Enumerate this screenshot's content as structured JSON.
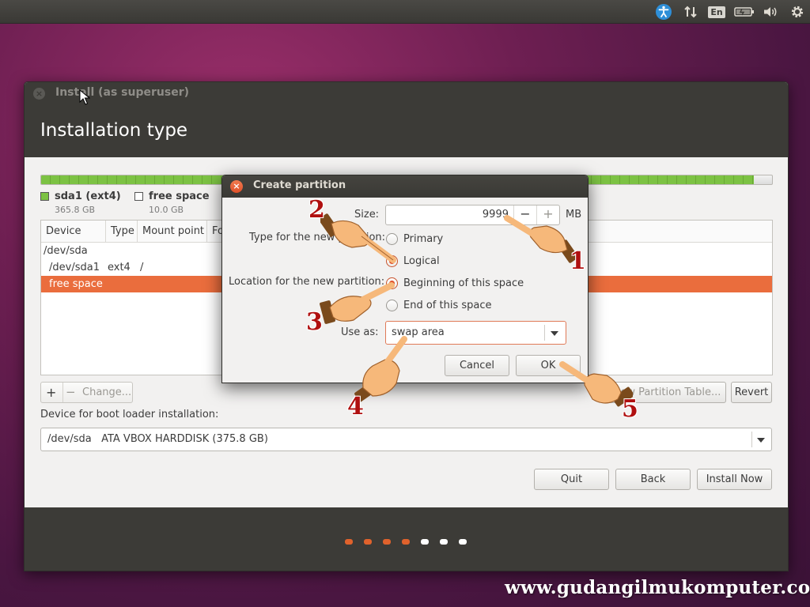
{
  "top_panel": {
    "icons": [
      "accessibility-icon",
      "network-arrows-icon",
      "keyboard-layout-icon",
      "battery-icon",
      "volume-icon",
      "settings-gear-icon"
    ],
    "keyboard_layout": "En"
  },
  "window": {
    "title": "Install (as superuser)",
    "page_title": "Installation type",
    "disk_bar": {
      "used_fraction": 0.975,
      "used_color": "#7cc243",
      "free_color": "#e6e6e6"
    },
    "legend": [
      {
        "name": "sda1 (ext4)",
        "size": "365.8 GB",
        "color": "#7cc243"
      },
      {
        "name": "free space",
        "size": "10.0 GB",
        "color": "#ffffff"
      }
    ],
    "table": {
      "columns": [
        "Device",
        "Type",
        "Mount point",
        "Fo"
      ],
      "rows": [
        {
          "device": "/dev/sda",
          "type": "",
          "mount": ""
        },
        {
          "device": "/dev/sda1",
          "type": "ext4",
          "mount": "/"
        },
        {
          "device": "free space",
          "type": "",
          "mount": "",
          "selected": true
        }
      ]
    },
    "toolbar": {
      "add": "+",
      "remove": "−",
      "change": "Change...",
      "new_table": "New Partition Table...",
      "revert": "Revert"
    },
    "boot_label": "Device for boot loader installation:",
    "boot_device": "/dev/sda   ATA VBOX HARDDISK (375.8 GB)",
    "buttons": {
      "quit": "Quit",
      "back": "Back",
      "install_now": "Install Now"
    },
    "progress": {
      "total_steps": 7,
      "completed_steps": 4,
      "active_color": "#e0622c",
      "inactive_color": "#ffffff"
    }
  },
  "dialog": {
    "title": "Create partition",
    "size_label": "Size:",
    "size_value": "9999",
    "size_unit": "MB",
    "minus": "−",
    "plus": "+",
    "type_label": "Type for the new partition:",
    "type_options": [
      {
        "label": "Primary",
        "selected": false
      },
      {
        "label": "Logical",
        "selected": true
      }
    ],
    "location_label": "Location for the new partition:",
    "location_options": [
      {
        "label": "Beginning of this space",
        "selected": true
      },
      {
        "label": "End of this space",
        "selected": false
      }
    ],
    "use_as_label": "Use as:",
    "use_as_value": "swap area",
    "cancel": "Cancel",
    "ok": "OK"
  },
  "annotations": {
    "steps": [
      "1",
      "2",
      "3",
      "4",
      "5"
    ]
  },
  "watermark": "www.gudangilmukomputer.com"
}
